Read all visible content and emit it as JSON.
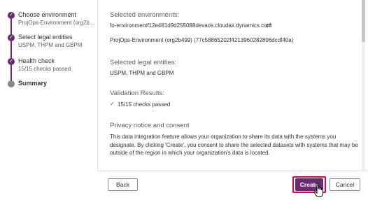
{
  "stepper": {
    "steps": [
      {
        "title": "Choose environment",
        "subtitle": "ProjOps-Environment (org2b...",
        "status": "done",
        "icon": "check-icon"
      },
      {
        "title": "Select legal entities",
        "subtitle": "USPM, THPM and GBPM",
        "status": "done",
        "icon": "check-icon"
      },
      {
        "title": "Health check",
        "subtitle": "15/15 checks passed",
        "status": "done",
        "icon": "check-icon"
      },
      {
        "title": "Summary",
        "subtitle": "",
        "status": "current",
        "icon": "dot-icon"
      }
    ]
  },
  "summary": {
    "environments_label": "Selected environments:",
    "environment_url": "fo-environmentf12e481d9d255088devaos.cloudax.dynamics.com",
    "environment_name": "ProjOps-Environment (org2b499) (77c58865202f4213960282806dcdf40a)",
    "legal_entities_label": "Selected legal entities:",
    "legal_entities_value": "USPM, THPM and GBPM",
    "validation_label": "Validation Results:",
    "validation_value": "15/15 checks passed",
    "privacy_label": "Privacy notice and consent",
    "privacy_text": "This data integration feature allows your organization to share its data with the systems you designate. By clicking 'Create', you consent to share the selected datasets with systems that may be outside of the region in which your organization's data is located."
  },
  "footer": {
    "back_label": "Back",
    "create_label": "Create",
    "cancel_label": "Cancel"
  },
  "colors": {
    "accent": "#6b2a6f",
    "focus_outline": "#e0004d",
    "pending": "#8a8886"
  }
}
